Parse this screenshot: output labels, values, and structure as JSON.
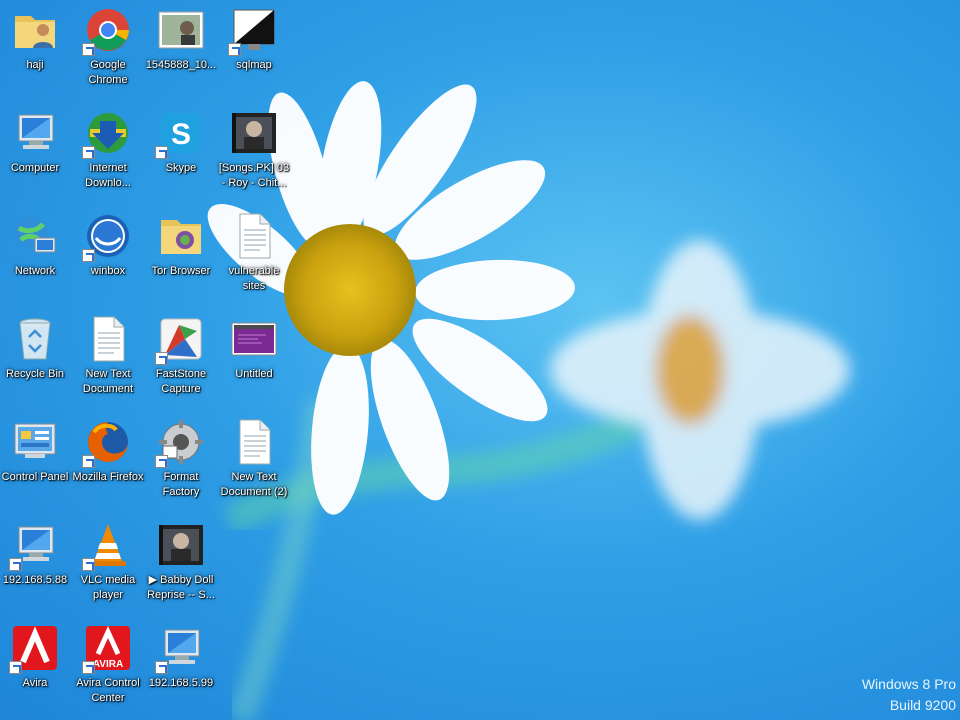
{
  "desktop": {
    "icons": [
      {
        "label": "haji",
        "name": "haji-folder-icon"
      },
      {
        "label": "Google Chrome",
        "name": "google-chrome-icon"
      },
      {
        "label": "1545888_10...",
        "name": "photo-file-icon"
      },
      {
        "label": "sqlmap",
        "name": "sqlmap-icon"
      },
      {
        "label": "Computer",
        "name": "computer-icon"
      },
      {
        "label": "Internet Downlo...",
        "name": "internet-download-manager-icon"
      },
      {
        "label": "Skype",
        "name": "skype-icon"
      },
      {
        "label": "[Songs.PK] 03 - Roy - Chit...",
        "name": "video-file-icon"
      },
      {
        "label": "Network",
        "name": "network-icon"
      },
      {
        "label": "winbox",
        "name": "winbox-icon"
      },
      {
        "label": "Tor Browser",
        "name": "tor-browser-folder-icon"
      },
      {
        "label": "vulnerable sites",
        "name": "text-document-icon"
      },
      {
        "label": "Recycle Bin",
        "name": "recycle-bin-icon"
      },
      {
        "label": "New Text Document",
        "name": "text-document-icon"
      },
      {
        "label": "FastStone Capture",
        "name": "faststone-capture-icon"
      },
      {
        "label": "Untitled",
        "name": "untitled-image-icon"
      },
      {
        "label": "Control Panel",
        "name": "control-panel-icon"
      },
      {
        "label": "Mozilla Firefox",
        "name": "firefox-icon"
      },
      {
        "label": "Format Factory",
        "name": "format-factory-icon"
      },
      {
        "label": "New Text Document (2)",
        "name": "text-document-icon"
      },
      {
        "label": "192.168.5.88",
        "name": "remote-desktop-icon"
      },
      {
        "label": "VLC media player",
        "name": "vlc-icon"
      },
      {
        "label": "▶ Babby Doll Reprise -- S...",
        "name": "video-file-icon"
      },
      {
        "label": "Avira",
        "name": "avira-icon"
      },
      {
        "label": "Avira Control Center",
        "name": "avira-control-center-icon"
      },
      {
        "label": "192.168.5.99",
        "name": "remote-desktop-icon"
      }
    ]
  },
  "watermark": {
    "line1": "Windows 8 Pro",
    "line2": "Build 9200"
  },
  "colors": {
    "wallpaper_blue": "#2f9fe6",
    "label_text": "#ffffff"
  }
}
